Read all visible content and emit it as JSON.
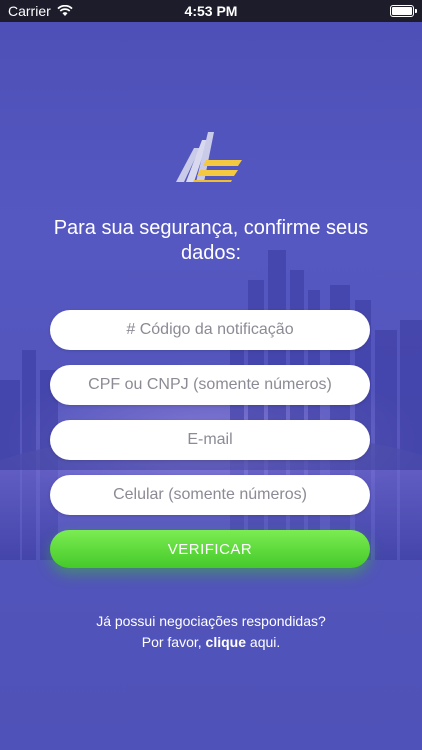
{
  "status_bar": {
    "carrier": "Carrier",
    "time": "4:53 PM"
  },
  "logo": {
    "name": "app-logo",
    "colors": {
      "stripes": "#c9cbe8",
      "accent": "#f5c842"
    }
  },
  "title": "Para sua segurança, confirme seus dados:",
  "form": {
    "notification_code_placeholder": "# Código da notificação",
    "cpf_cnpj_placeholder": "CPF ou CNPJ (somente números)",
    "email_placeholder": "E-mail",
    "phone_placeholder": "Celular (somente números)",
    "verify_label": "VERIFICAR"
  },
  "footer": {
    "line1": "Já possui negociações respondidas?",
    "line2_prefix": "Por favor, ",
    "link_label": "clique",
    "line2_suffix": " aqui."
  },
  "colors": {
    "background": "#5355bb",
    "button": "#55d43a"
  }
}
